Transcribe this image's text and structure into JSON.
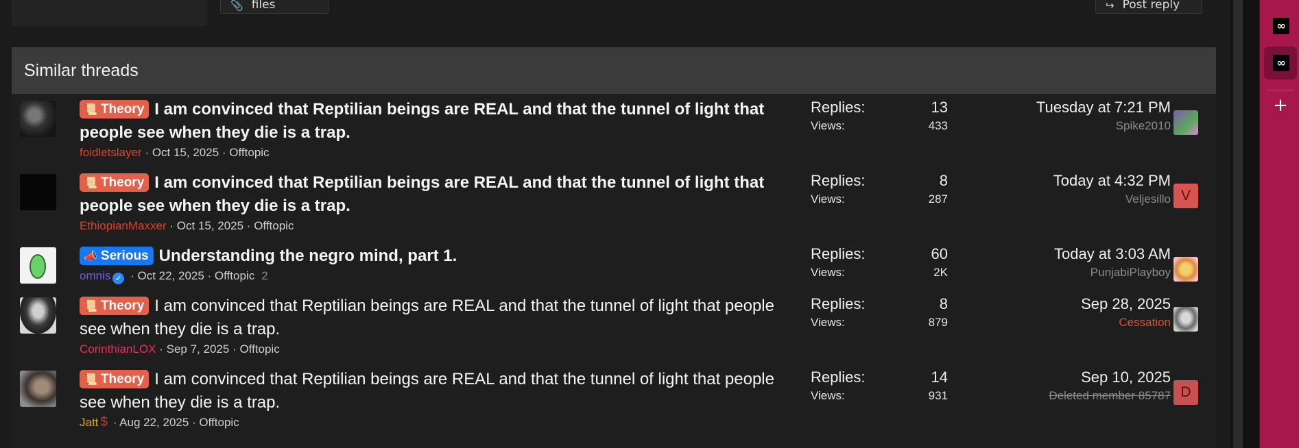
{
  "toolbar": {
    "attach_label": "Attach files",
    "post_reply_label": "Post reply"
  },
  "similar_threads": {
    "header": "Similar threads",
    "threads": [
      {
        "prefix": "Theory",
        "title": "I am convinced that Reptilian beings are REAL and that the tunnel of light that people see when they die is a trap.",
        "unread": true,
        "author": "foidletslayer",
        "date": "Oct 15, 2025",
        "forum": "Offtopic",
        "replies_label": "Replies:",
        "replies": "13",
        "views_label": "Views:",
        "views": "433",
        "last_post_date": "Tuesday at 7:21 PM",
        "last_post_user": "Spike2010",
        "last_avatar_letter": ""
      },
      {
        "prefix": "Theory",
        "title": "I am convinced that Reptilian beings are REAL and that the tunnel of light that people see when they die is a trap.",
        "unread": true,
        "author": "EthiopianMaxxer",
        "date": "Oct 15, 2025",
        "forum": "Offtopic",
        "replies_label": "Replies:",
        "replies": "8",
        "views_label": "Views:",
        "views": "287",
        "last_post_date": "Today at 4:32 PM",
        "last_post_user": "Veljesillo",
        "last_avatar_letter": "V"
      },
      {
        "prefix": "Serious",
        "title": "Understanding the negro mind, part 1.",
        "unread": true,
        "author": "omnis",
        "date": "Oct 22, 2025",
        "forum": "Offtopic",
        "pages": "2",
        "replies_label": "Replies:",
        "replies": "60",
        "views_label": "Views:",
        "views": "2K",
        "last_post_date": "Today at 3:03 AM",
        "last_post_user": "PunjabiPlayboy",
        "last_avatar_letter": ""
      },
      {
        "prefix": "Theory",
        "title": "I am convinced that Reptilian beings are REAL and that the tunnel of light that people see when they die is a trap.",
        "unread": false,
        "author": "CorinthianLOX",
        "date": "Sep 7, 2025",
        "forum": "Offtopic",
        "replies_label": "Replies:",
        "replies": "8",
        "views_label": "Views:",
        "views": "879",
        "last_post_date": "Sep 28, 2025",
        "last_post_user": "Cessation",
        "last_avatar_letter": ""
      },
      {
        "prefix": "Theory",
        "title": "I am convinced that Reptilian beings are REAL and that the tunnel of light that people see when they die is a trap.",
        "unread": false,
        "author": "Jatt",
        "date": "Aug 22, 2025",
        "forum": "Offtopic",
        "replies_label": "Replies:",
        "replies": "14",
        "views_label": "Views:",
        "views": "931",
        "last_post_date": "Sep 10, 2025",
        "last_post_user": "Deleted member 85787",
        "last_avatar_letter": "D"
      }
    ]
  },
  "meta_separator": " · ",
  "icons": {
    "attach": "paperclip-icon",
    "post_reply": "reply-icon",
    "theory_prefix": "scroll-icon",
    "serious_prefix": "megaphone-icon",
    "verified": "verified-check-icon",
    "donor": "dollar-icon",
    "sidebar_app": "infinity-icon",
    "sidebar_add": "plus-icon"
  },
  "colors": {
    "theory_prefix": "#e3604a",
    "serious_prefix": "#1877f2",
    "sidebar": "#a6174c",
    "header_bar": "#3b3b3b"
  }
}
